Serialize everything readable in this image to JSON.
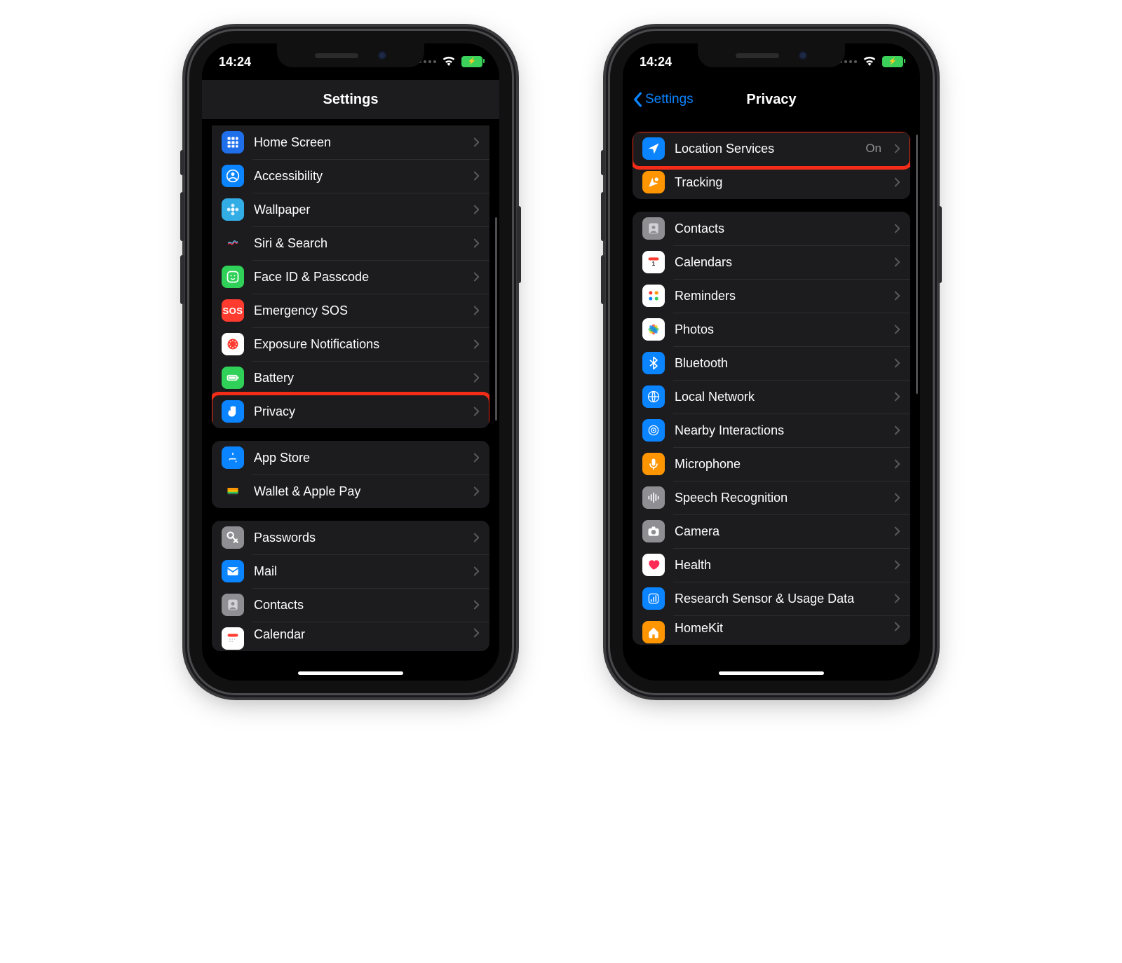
{
  "status": {
    "time": "14:24"
  },
  "phones": {
    "left": {
      "nav": {
        "title": "Settings"
      },
      "groups": [
        {
          "id": "g1",
          "trim_top": true,
          "rows": [
            {
              "id": "home-screen",
              "label": "Home Screen",
              "icon": "grid",
              "color": "#1f6feb"
            },
            {
              "id": "accessibility",
              "label": "Accessibility",
              "icon": "person-circle",
              "color": "#0a84ff"
            },
            {
              "id": "wallpaper",
              "label": "Wallpaper",
              "icon": "flower",
              "color": "#32ade6"
            },
            {
              "id": "siri",
              "label": "Siri & Search",
              "icon": "siri",
              "color": "#1c1c1e"
            },
            {
              "id": "faceid",
              "label": "Face ID & Passcode",
              "icon": "faceid",
              "color": "#30d158"
            },
            {
              "id": "sos",
              "label": "Emergency SOS",
              "icon": "sos",
              "color": "#ff3b30"
            },
            {
              "id": "exposure",
              "label": "Exposure Notifications",
              "icon": "exposure",
              "color": "#ffffff"
            },
            {
              "id": "battery",
              "label": "Battery",
              "icon": "battery",
              "color": "#30d158"
            },
            {
              "id": "privacy",
              "label": "Privacy",
              "icon": "hand",
              "color": "#0a84ff",
              "highlighted": true
            }
          ]
        },
        {
          "id": "g2",
          "rows": [
            {
              "id": "appstore",
              "label": "App Store",
              "icon": "appstore",
              "color": "#0a84ff"
            },
            {
              "id": "wallet",
              "label": "Wallet & Apple Pay",
              "icon": "wallet",
              "color": "#1c1c1e"
            }
          ]
        },
        {
          "id": "g3",
          "rows": [
            {
              "id": "passwords",
              "label": "Passwords",
              "icon": "key",
              "color": "#8e8e93"
            },
            {
              "id": "mail",
              "label": "Mail",
              "icon": "mail",
              "color": "#0a84ff"
            },
            {
              "id": "contacts2",
              "label": "Contacts",
              "icon": "contacts",
              "color": "#8e8e93"
            },
            {
              "id": "calendar2",
              "label": "Calendar",
              "icon": "calendar-red",
              "color": "#ffffff",
              "cutoff": true
            }
          ]
        }
      ]
    },
    "right": {
      "nav": {
        "title": "Privacy",
        "back": "Settings"
      },
      "groups": [
        {
          "id": "pg1",
          "rows": [
            {
              "id": "location",
              "label": "Location Services",
              "icon": "location",
              "color": "#0a84ff",
              "value": "On",
              "highlighted": true
            },
            {
              "id": "tracking",
              "label": "Tracking",
              "icon": "tracking",
              "color": "#ff9500"
            }
          ]
        },
        {
          "id": "pg2",
          "rows": [
            {
              "id": "contacts",
              "label": "Contacts",
              "icon": "contacts",
              "color": "#8e8e93"
            },
            {
              "id": "calendars",
              "label": "Calendars",
              "icon": "calendar",
              "color": "#ffffff"
            },
            {
              "id": "reminders",
              "label": "Reminders",
              "icon": "reminders",
              "color": "#ffffff"
            },
            {
              "id": "photos",
              "label": "Photos",
              "icon": "photos",
              "color": "#ffffff"
            },
            {
              "id": "bluetooth",
              "label": "Bluetooth",
              "icon": "bluetooth",
              "color": "#0a84ff"
            },
            {
              "id": "localnet",
              "label": "Local Network",
              "icon": "globe",
              "color": "#0a84ff"
            },
            {
              "id": "nearby",
              "label": "Nearby Interactions",
              "icon": "target",
              "color": "#0a84ff"
            },
            {
              "id": "mic",
              "label": "Microphone",
              "icon": "mic",
              "color": "#ff9500"
            },
            {
              "id": "speech",
              "label": "Speech Recognition",
              "icon": "waveform",
              "color": "#8e8e93"
            },
            {
              "id": "camera",
              "label": "Camera",
              "icon": "camera",
              "color": "#8e8e93"
            },
            {
              "id": "health",
              "label": "Health",
              "icon": "heart",
              "color": "#ffffff"
            },
            {
              "id": "research",
              "label": "Research Sensor & Usage Data",
              "icon": "research",
              "color": "#0a84ff"
            },
            {
              "id": "homekit",
              "label": "HomeKit",
              "icon": "home",
              "color": "#ff9500",
              "cutoff": true
            }
          ]
        }
      ]
    }
  }
}
